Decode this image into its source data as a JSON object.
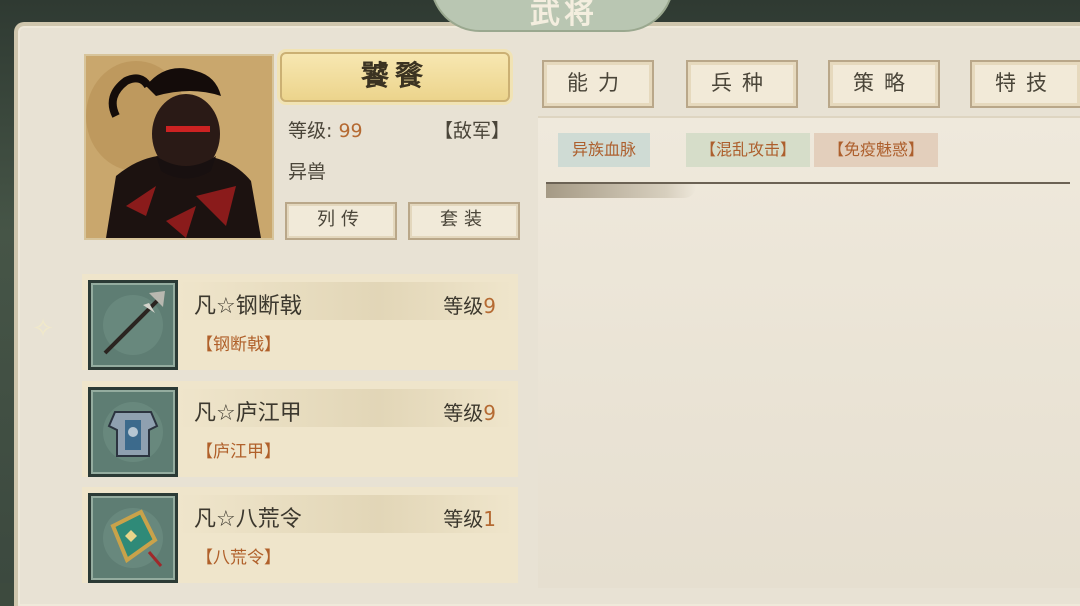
{
  "title": "武将",
  "hero": {
    "name": "饕餮",
    "level_label": "等级:",
    "level_value": "99",
    "faction": "【敌军】",
    "type": "异兽"
  },
  "buttons": {
    "biography": "列传",
    "outfit": "套装"
  },
  "tabs": [
    {
      "label": "能力"
    },
    {
      "label": "兵种"
    },
    {
      "label": "策略"
    },
    {
      "label": "特技"
    }
  ],
  "skill_tags": [
    "异族血脉",
    "【混乱攻击】",
    "【免疫魅惑】"
  ],
  "equipment": [
    {
      "name": "凡☆钢断戟",
      "level_label": "等级",
      "level": "9",
      "sub": "【钢断戟】",
      "icon": "halberd-icon"
    },
    {
      "name": "凡☆庐江甲",
      "level_label": "等级",
      "level": "9",
      "sub": "【庐江甲】",
      "icon": "armor-icon"
    },
    {
      "name": "凡☆八荒令",
      "level_label": "等级",
      "level": "1",
      "sub": "【八荒令】",
      "icon": "token-icon"
    }
  ],
  "colors": {
    "accent_orange": "#b56a32",
    "panel": "#e8e2d4",
    "nameplate": "#f2dd9c"
  }
}
